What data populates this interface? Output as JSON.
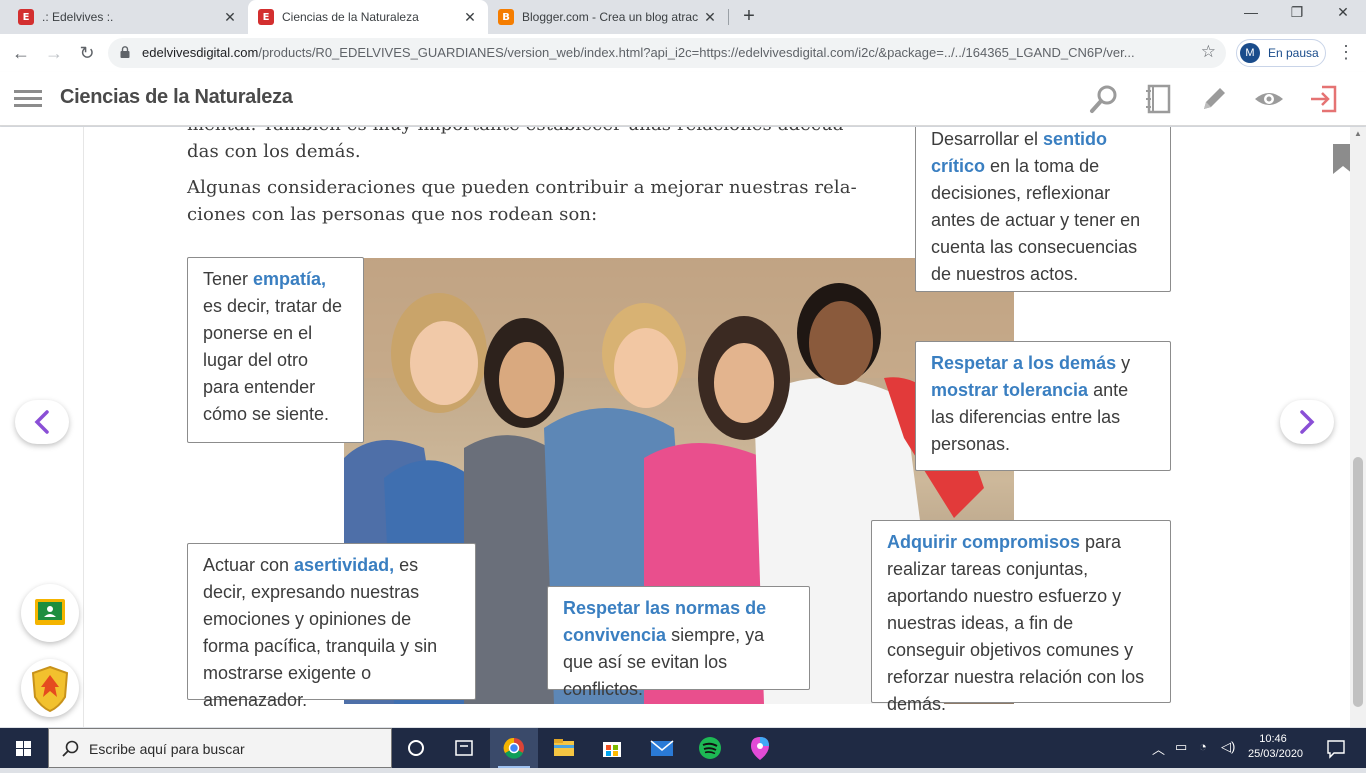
{
  "browser": {
    "tabs": [
      {
        "title": ".: Edelvives :.",
        "favicon": "E"
      },
      {
        "title": "Ciencias de la Naturaleza",
        "favicon": "E"
      },
      {
        "title": "Blogger.com - Crea un blog atrac",
        "favicon": "B"
      }
    ],
    "url_domain": "edelvivesdigital.com",
    "url_rest": "/products/R0_EDELVIVES_GUARDIANES/version_web/index.html?api_i2c=https://edelvivesdigital.com/i2c/&package=../../164365_LGAND_CN6P/ver...",
    "profile_initial": "M",
    "profile_label": "En pausa"
  },
  "app": {
    "title": "Ciencias de la Naturaleza",
    "icons": [
      "search-icon",
      "notebook-icon",
      "pencil-icon",
      "eye-icon",
      "exit-icon"
    ]
  },
  "content": {
    "para1_line0": "mental. También es muy importante establecer unas relaciones adecua-",
    "para1_line1": "das con los demás.",
    "para2_line0": "Algunas consideraciones que pueden contribuir a mejorar nuestras rela-",
    "para2_line1": "ciones con las personas que nos rodean son:",
    "box_empatia": {
      "pre": "Tener ",
      "hl": "empatía,",
      "post": " es decir, tratar de ponerse en el lugar del otro para entender cómo se siente."
    },
    "box_critico": {
      "pre": "Desarrollar el ",
      "hl": "sentido crítico",
      "post": " en la toma de decisiones, reflexionar antes de actuar y tener en cuenta las consecuencias de nuestros actos."
    },
    "box_respetar": {
      "hl1": "Respetar a los demás",
      "mid": " y ",
      "hl2": "mostrar tolerancia",
      "post": " ante las diferencias entre las personas."
    },
    "box_asertividad": {
      "pre": "Actuar con ",
      "hl": "asertividad,",
      "post": " es decir, expresando nuestras emociones y opiniones de forma pacífica, tranquila y sin mostrarse exigente o amenazador."
    },
    "box_normas": {
      "hl": "Respetar las normas de convivencia",
      "post": " siempre, ya que así se evitan los conflictos."
    },
    "box_compromisos": {
      "hl": "Adquirir compromisos",
      "post": " para realizar tareas conjuntas, aportando nuestro esfuerzo y nuestras ideas, a fin de conseguir objetivos comunes y reforzar nuestra relación con los demás."
    }
  },
  "taskbar": {
    "search_placeholder": "Escribe aquí para buscar",
    "time": "10:46",
    "date": "25/03/2020"
  },
  "colors": {
    "highlight": "#3a7fc1",
    "nav_arrow": "#8a4fd6",
    "taskbar": "#1f2a44"
  }
}
